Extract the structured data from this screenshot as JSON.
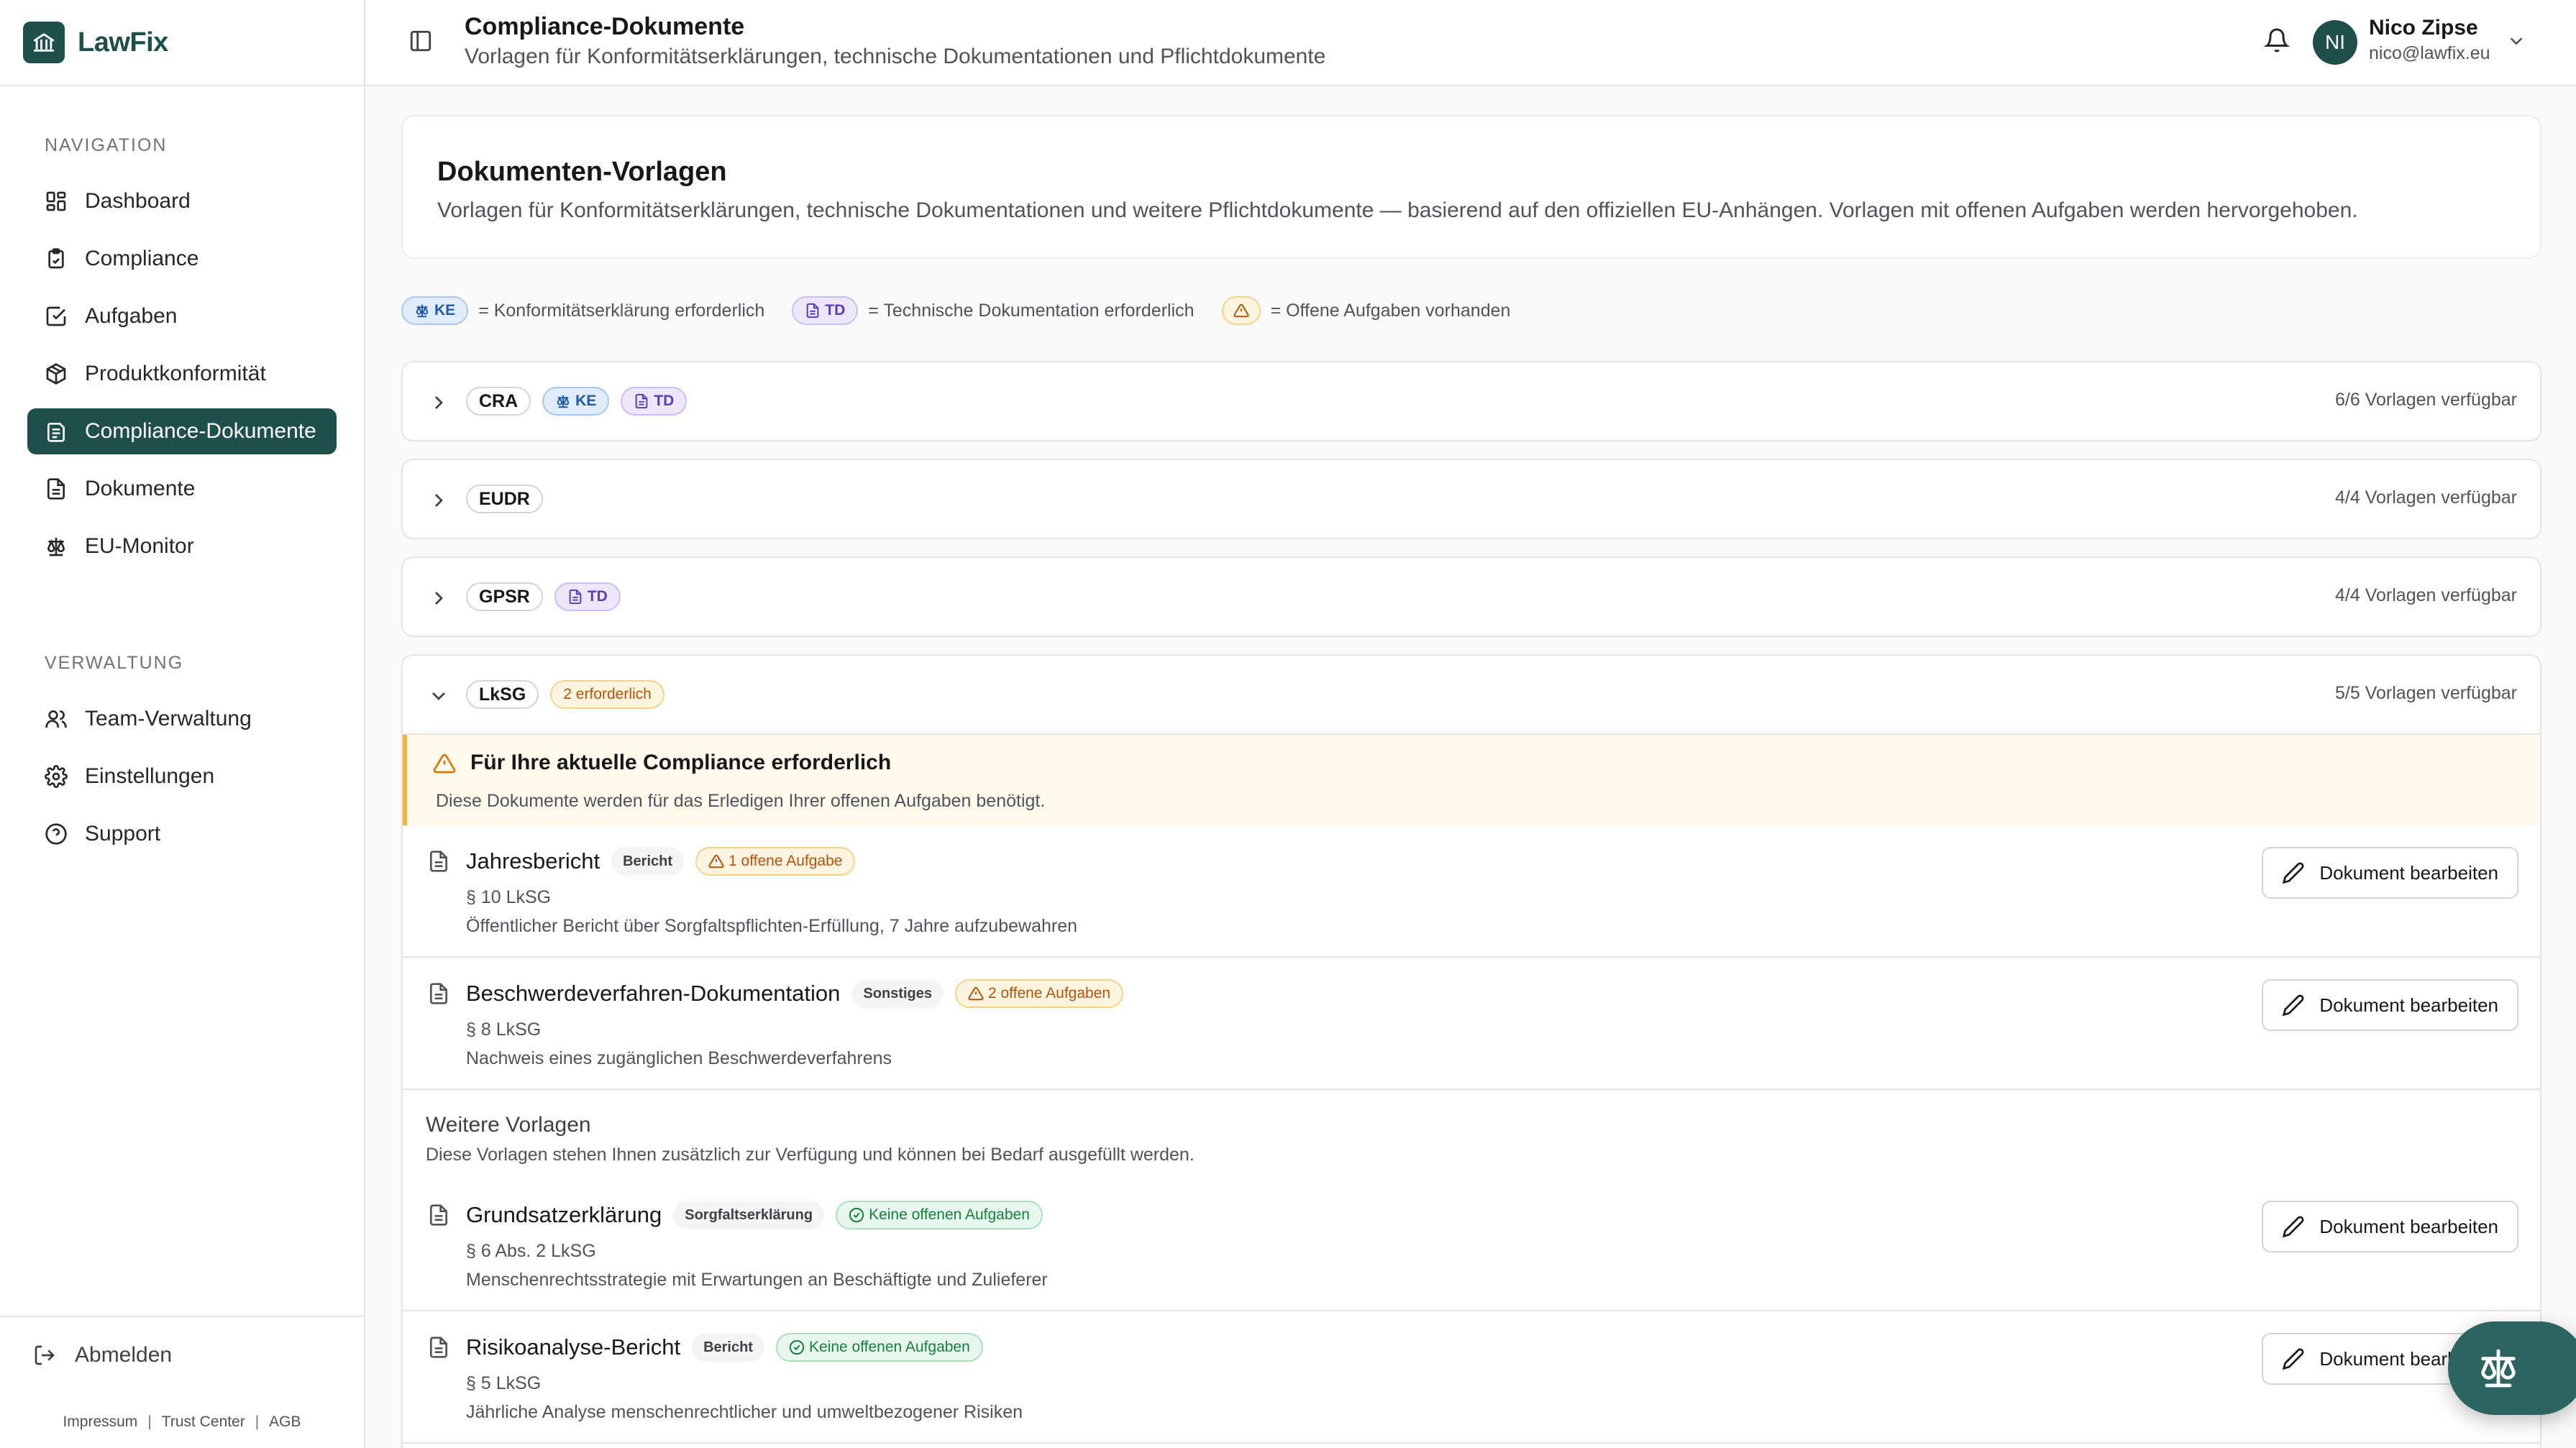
{
  "app": {
    "name": "LawFix"
  },
  "header": {
    "title": "Compliance-Dokumente",
    "subtitle": "Vorlagen für Konformitätserklärungen, technische Dokumentationen und Pflichtdokumente"
  },
  "user": {
    "initials": "NI",
    "name": "Nico Zipse",
    "email": "nico@lawfix.eu"
  },
  "sidebar": {
    "nav_label": "NAVIGATION",
    "admin_label": "VERWALTUNG",
    "items": [
      {
        "label": "Dashboard",
        "icon": "dashboard-icon"
      },
      {
        "label": "Compliance",
        "icon": "clipboard-icon"
      },
      {
        "label": "Aufgaben",
        "icon": "checkbox-icon"
      },
      {
        "label": "Produktkonformität",
        "icon": "package-icon"
      },
      {
        "label": "Compliance-Dokumente",
        "icon": "document-stack-icon",
        "active": true
      },
      {
        "label": "Dokumente",
        "icon": "file-icon"
      },
      {
        "label": "EU-Monitor",
        "icon": "scale-icon"
      }
    ],
    "admin_items": [
      {
        "label": "Team-Verwaltung",
        "icon": "users-icon"
      },
      {
        "label": "Einstellungen",
        "icon": "gear-icon"
      },
      {
        "label": "Support",
        "icon": "help-icon"
      }
    ],
    "logout": "Abmelden",
    "legal": [
      "Impressum",
      "Trust Center",
      "AGB"
    ]
  },
  "intro": {
    "title": "Dokumenten-Vorlagen",
    "text": "Vorlagen für Konformitätserklärungen, technische Dokumentationen und weitere Pflichtdokumente — basierend auf den offiziellen EU-Anhängen. Vorlagen mit offenen Aufgaben werden hervorgehoben."
  },
  "legend": {
    "ke": "KE",
    "ke_text": "= Konformitätserklärung erforderlich",
    "td": "TD",
    "td_text": "= Technische Dokumentation erforderlich",
    "warn_text": "= Offene Aufgaben vorhanden"
  },
  "groups": [
    {
      "code": "CRA",
      "badges": [
        "KE",
        "TD"
      ],
      "count": "6/6 Vorlagen verfügbar"
    },
    {
      "code": "EUDR",
      "badges": [],
      "count": "4/4 Vorlagen verfügbar"
    },
    {
      "code": "GPSR",
      "badges": [
        "TD"
      ],
      "count": "4/4 Vorlagen verfügbar"
    }
  ],
  "expanded": {
    "code": "LkSG",
    "required_badge": "2 erforderlich",
    "count": "5/5 Vorlagen verfügbar",
    "alert_title": "Für Ihre aktuelle Compliance erforderlich",
    "alert_desc": "Diese Dokumente werden für das Erledigen Ihrer offenen Aufgaben benötigt.",
    "more_title": "Weitere Vorlagen",
    "more_desc": "Diese Vorlagen stehen Ihnen zusätzlich zur Verfügung und können bei Bedarf ausgefüllt werden.",
    "edit_label": "Dokument bearbeiten",
    "required_docs": [
      {
        "name": "Jahresbericht",
        "category": "Bericht",
        "status": "1 offene Aufgabe",
        "ref": "§ 10 LkSG",
        "desc": "Öffentlicher Bericht über Sorgfaltspflichten-Erfüllung, 7 Jahre aufzubewahren"
      },
      {
        "name": "Beschwerdeverfahren-Dokumentation",
        "category": "Sonstiges",
        "status": "2 offene Aufgaben",
        "ref": "§ 8 LkSG",
        "desc": "Nachweis eines zugänglichen Beschwerdeverfahrens"
      }
    ],
    "more_docs": [
      {
        "name": "Grundsatzerklärung",
        "category": "Sorgfaltserklärung",
        "status": "Keine offenen Aufgaben",
        "ref": "§ 6 Abs. 2 LkSG",
        "desc": "Menschenrechtsstrategie mit Erwartungen an Beschäftigte und Zulieferer"
      },
      {
        "name": "Risikoanalyse-Bericht",
        "category": "Bericht",
        "status": "Keine offenen Aufgaben",
        "ref": "§ 5 LkSG",
        "desc": "Jährliche Analyse menschenrechtlicher und umweltbezogener Risiken"
      }
    ]
  },
  "colors": {
    "brand": "#1f4f4a",
    "warn": "#f0b43c",
    "ok": "#15803d"
  }
}
